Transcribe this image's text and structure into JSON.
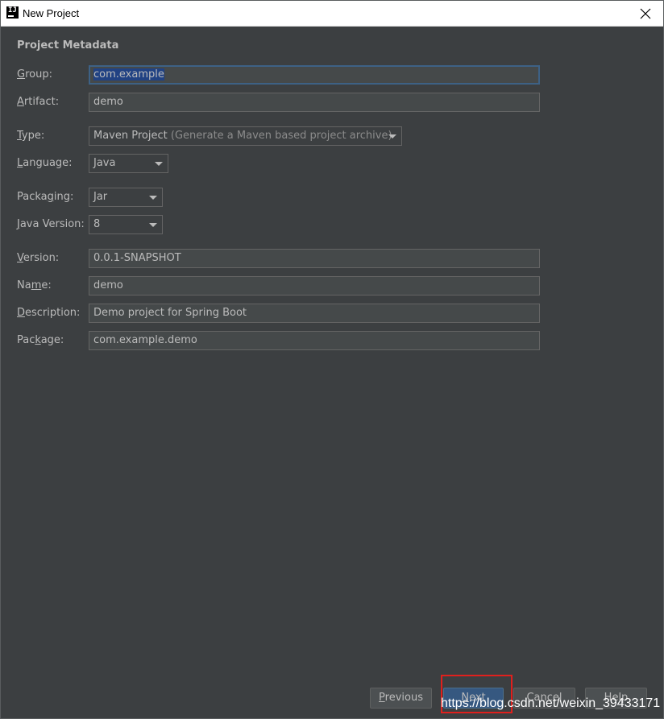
{
  "window": {
    "title": "New Project",
    "icon_text": "IJ"
  },
  "section": {
    "title": "Project Metadata"
  },
  "fields": {
    "group": {
      "label_mn": "G",
      "label_rest": "roup:",
      "value": "com.example"
    },
    "artifact": {
      "label_mn": "A",
      "label_rest": "rtifact:",
      "value": "demo"
    },
    "type": {
      "label_mn": "T",
      "label_rest": "ype:",
      "value": "Maven Project",
      "hint": "(Generate a Maven based project archive)"
    },
    "language": {
      "label_pre": "",
      "label_mn": "L",
      "label_rest": "anguage:",
      "value": "Java"
    },
    "packaging": {
      "label_pre": "Packa",
      "label_mn": "g",
      "label_rest": "ing:",
      "value": "Jar"
    },
    "java_version": {
      "label_mn": "J",
      "label_rest": "ava Version:",
      "value": "8"
    },
    "version": {
      "label_mn": "V",
      "label_rest": "ersion:",
      "value": "0.0.1-SNAPSHOT"
    },
    "name": {
      "label_pre": "Na",
      "label_mn": "m",
      "label_rest": "e:",
      "value": "demo"
    },
    "description": {
      "label_mn": "D",
      "label_rest": "escription:",
      "value": "Demo project for Spring Boot"
    },
    "package": {
      "label_pre": "Pac",
      "label_mn": "k",
      "label_rest": "age:",
      "value": "com.example.demo"
    }
  },
  "buttons": {
    "previous_pre": "",
    "previous_mn": "P",
    "previous_rest": "revious",
    "next_mn": "N",
    "next_rest": "ext",
    "cancel": "Cancel",
    "help": "Help"
  },
  "watermark": "https://blog.csdn.net/weixin_39433171",
  "colors": {
    "background": "#3c3f41",
    "field_bg": "#45494a",
    "focus_border": "#3d6185",
    "selection": "#214283",
    "default_button": "#365880",
    "annotation_red": "#e0201d"
  }
}
